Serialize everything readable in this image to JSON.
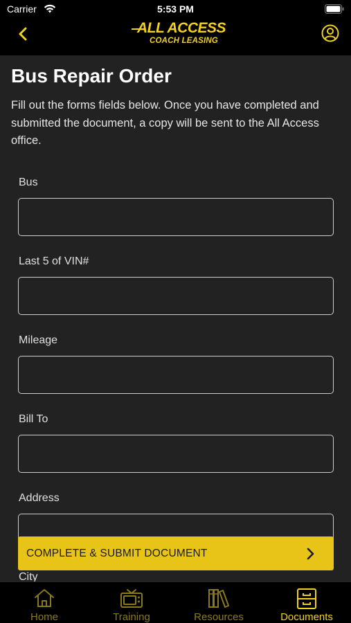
{
  "status": {
    "carrier": "Carrier",
    "time": "5:53 PM"
  },
  "header": {
    "logo_main": "ALL ACCESS",
    "logo_sub": "COACH LEASING"
  },
  "page": {
    "title": "Bus Repair Order",
    "intro": "Fill out the forms fields below. Once you have completed and submitted the document, a copy will be sent to the All Access office."
  },
  "form": {
    "fields": [
      {
        "label": "Bus",
        "value": ""
      },
      {
        "label": "Last 5 of VIN#",
        "value": ""
      },
      {
        "label": "Mileage",
        "value": ""
      },
      {
        "label": "Bill To",
        "value": ""
      },
      {
        "label": "Address",
        "value": ""
      },
      {
        "label": "City",
        "value": ""
      }
    ],
    "submit_label": "COMPLETE & SUBMIT DOCUMENT"
  },
  "tabs": [
    {
      "label": "Home",
      "icon": "home-icon",
      "active": false
    },
    {
      "label": "Training",
      "icon": "tv-icon",
      "active": false
    },
    {
      "label": "Resources",
      "icon": "books-icon",
      "active": false
    },
    {
      "label": "Documents",
      "icon": "file-cabinet-icon",
      "active": true
    }
  ],
  "colors": {
    "accent": "#f0d21e",
    "background": "#222222",
    "bar": "#000000"
  }
}
